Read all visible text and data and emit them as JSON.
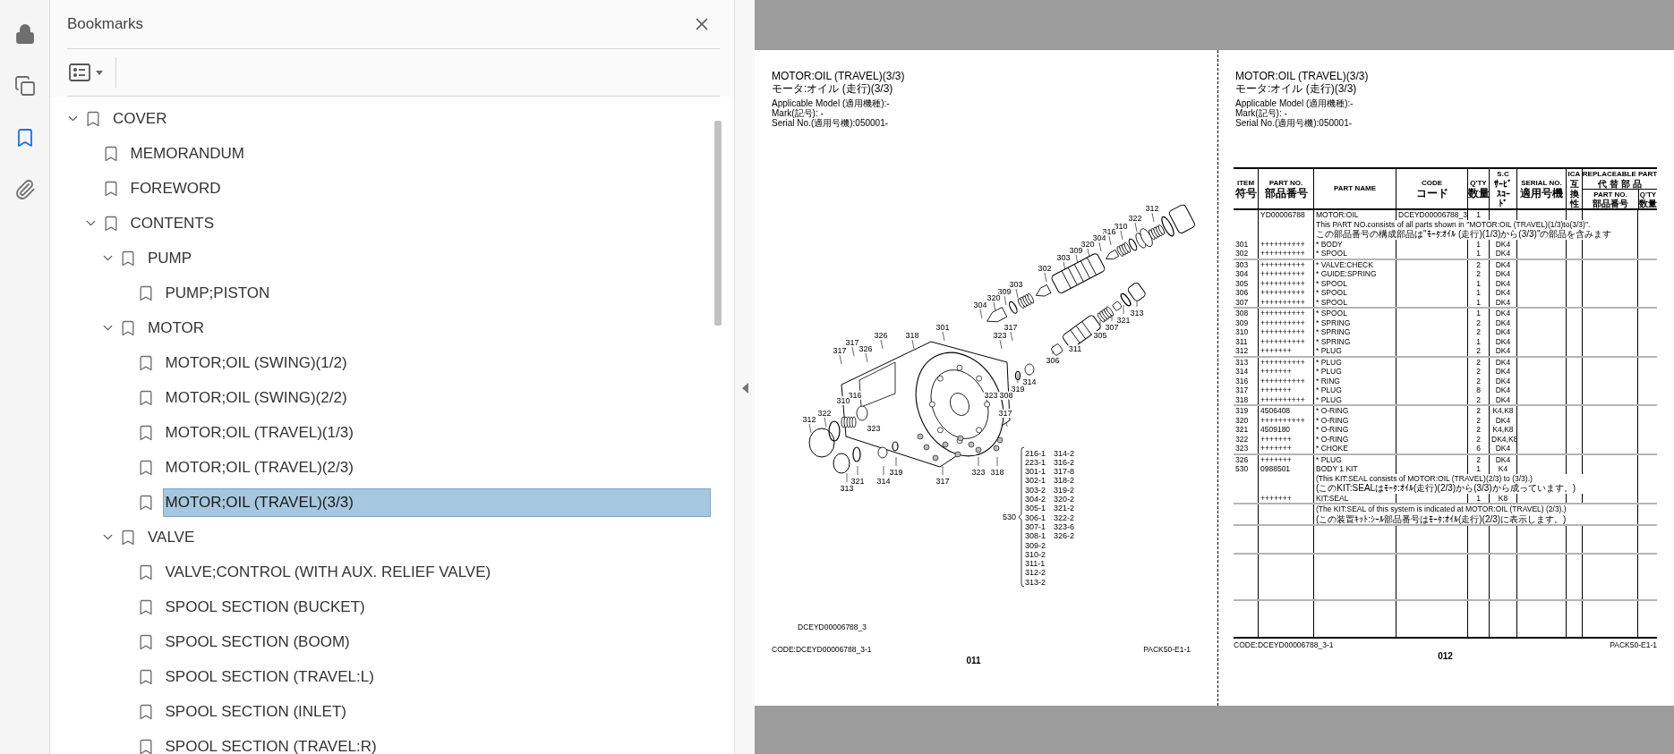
{
  "rail_tools": [
    {
      "selected": false
    },
    {
      "selected": false
    },
    {
      "selected": true
    },
    {
      "selected": false
    }
  ],
  "bookmarks_panel": {
    "title": "Bookmarks",
    "items": [
      {
        "label": "COVER",
        "selected": false,
        "expanded": true,
        "children": [
          {
            "label": "MEMORANDUM",
            "selected": false
          },
          {
            "label": "FOREWORD",
            "selected": false
          },
          {
            "label": "CONTENTS",
            "selected": false,
            "expanded": true,
            "children": [
              {
                "label": "PUMP",
                "selected": false,
                "expanded": true,
                "children": [
                  {
                    "label": "PUMP;PISTON",
                    "selected": false
                  }
                ]
              },
              {
                "label": "MOTOR",
                "selected": false,
                "expanded": true,
                "children": [
                  {
                    "label": "MOTOR;OIL (SWING)(1/2)",
                    "selected": false
                  },
                  {
                    "label": "MOTOR;OIL (SWING)(2/2)",
                    "selected": false
                  },
                  {
                    "label": "MOTOR;OIL (TRAVEL)(1/3)",
                    "selected": false
                  },
                  {
                    "label": "MOTOR;OIL (TRAVEL)(2/3)",
                    "selected": false
                  },
                  {
                    "label": "MOTOR;OIL (TRAVEL)(3/3)",
                    "selected": true
                  }
                ]
              },
              {
                "label": "VALVE",
                "selected": false,
                "expanded": true,
                "children": [
                  {
                    "label": "VALVE;CONTROL (WITH AUX. RELIEF VALVE)",
                    "selected": false
                  },
                  {
                    "label": "SPOOL SECTION (BUCKET)",
                    "selected": false
                  },
                  {
                    "label": "SPOOL SECTION (BOOM)",
                    "selected": false
                  },
                  {
                    "label": "SPOOL SECTION (TRAVEL:L)",
                    "selected": false
                  },
                  {
                    "label": "SPOOL SECTION (INLET)",
                    "selected": false
                  },
                  {
                    "label": "SPOOL SECTION (TRAVEL:R)",
                    "selected": false
                  }
                ]
              }
            ]
          }
        ]
      }
    ]
  },
  "left_page": {
    "title": "MOTOR:OIL (TRAVEL)(3/3)",
    "title_ja": "モータ:オイル (走行)(3/3)",
    "info": [
      "Applicable Model (適用機種):-",
      "Mark(記号): -",
      "Serial No.(適用号機):050001-"
    ],
    "callouts": [
      "312",
      "322",
      "310",
      "316",
      "304",
      "320",
      "309",
      "303",
      "302",
      "303",
      "309",
      "320",
      "304",
      "313",
      "321",
      "301",
      "317",
      "307",
      "326",
      "318",
      "323",
      "305",
      "317",
      "317",
      "326",
      "311",
      "306",
      "314",
      "319",
      "316",
      "323",
      "308",
      "310",
      "322",
      "317",
      "312",
      "323",
      "319",
      "323",
      "318",
      "321",
      "314",
      "317",
      "313"
    ],
    "kit": {
      "number": "530",
      "items": [
        "216-1",
        "223-1",
        "301-1",
        "302-1",
        "303-2",
        "304-2",
        "305-1",
        "306-1",
        "307-1",
        "308-1",
        "309-2",
        "310-2",
        "311-1",
        "312-2",
        "313-2",
        "314-2",
        "316-2",
        "317-8",
        "318-2",
        "319-2",
        "320-2",
        "321-2",
        "322-2",
        "323-6",
        "326-2"
      ]
    },
    "drawing_code": "DCEYD00006788_3",
    "footer_code": "CODE:DCEYD00006788_3-1",
    "footer_pack": "PACK50-E1-1",
    "page_number": "011"
  },
  "right_page": {
    "title": "MOTOR:OIL (TRAVEL)(3/3)",
    "title_ja": "モータ:オイル (走行)(3/3)",
    "info": [
      "Applicable Model (適用機種):-",
      "Mark(記号): -",
      "Serial No.(適用号機):050001-"
    ],
    "table": {
      "columns": [
        {
          "en": "ITEM",
          "ja": "符号"
        },
        {
          "en": "PART NO.",
          "ja": "部品番号"
        },
        {
          "en": "PART NAME"
        },
        {
          "en": "CODE",
          "ja": "コード"
        },
        {
          "en": "Q'TY",
          "ja": "数量"
        },
        {
          "en": "S.C",
          "ja": "ｻｰﾋﾞｽｺｰﾄﾞ"
        },
        {
          "en": "SERIAL NO.",
          "ja": "適用号機"
        },
        {
          "en": "ICA",
          "ja": "互換性"
        }
      ],
      "replaceable": {
        "en": "REPLACEABLE PART",
        "ja": "代 替 部 品",
        "columns": [
          {
            "en": "PART NO.",
            "ja": "部品番号"
          },
          {
            "en": "Q'TY",
            "ja": "数量"
          }
        ]
      },
      "groups": [
        {
          "rows": [
            {
              "kind": "item",
              "part_no": "YD00006788",
              "name": "MOTOR:OIL",
              "code": "DCEYD00006788_3",
              "qty": "1"
            },
            {
              "kind": "note",
              "text": "This PART NO.consists of all parts shown in \"MOTOR:OIL (TRAVEL)(1/3)to(3/3)\"."
            },
            {
              "kind": "note_ja",
              "text": "この部品番号の構成部品は\"ﾓｰﾀ:ｵｲﾙ (走行)(1/3)から(3/3)\"の部品を含みます"
            },
            {
              "kind": "item",
              "item": "301",
              "part_no": "++++++++++",
              "name": "* BODY",
              "qty": "1",
              "sc": "DK4"
            },
            {
              "kind": "item",
              "item": "302",
              "part_no": "++++++++++",
              "name": "* SPOOL",
              "qty": "1",
              "sc": "DK4"
            }
          ]
        },
        {
          "rows": [
            {
              "kind": "item",
              "item": "303",
              "part_no": "++++++++++",
              "name": "* VALVE:CHECK",
              "qty": "2",
              "sc": "DK4"
            },
            {
              "kind": "item",
              "item": "304",
              "part_no": "++++++++++",
              "name": "* GUIDE:SPRING",
              "qty": "2",
              "sc": "DK4"
            },
            {
              "kind": "item",
              "item": "305",
              "part_no": "++++++++++",
              "name": "* SPOOL",
              "qty": "1",
              "sc": "DK4"
            },
            {
              "kind": "item",
              "item": "306",
              "part_no": "++++++++++",
              "name": "* SPOOL",
              "qty": "1",
              "sc": "DK4"
            },
            {
              "kind": "item",
              "item": "307",
              "part_no": "++++++++++",
              "name": "* SPOOL",
              "qty": "1",
              "sc": "DK4"
            }
          ]
        },
        {
          "rows": [
            {
              "kind": "item",
              "item": "308",
              "part_no": "++++++++++",
              "name": "* SPOOL",
              "qty": "1",
              "sc": "DK4"
            },
            {
              "kind": "item",
              "item": "309",
              "part_no": "++++++++++",
              "name": "* SPRING",
              "qty": "2",
              "sc": "DK4"
            },
            {
              "kind": "item",
              "item": "310",
              "part_no": "++++++++++",
              "name": "* SPRING",
              "qty": "2",
              "sc": "DK4"
            },
            {
              "kind": "item",
              "item": "311",
              "part_no": "++++++++++",
              "name": "* SPRING",
              "qty": "1",
              "sc": "DK4"
            },
            {
              "kind": "item",
              "item": "312",
              "part_no": "+++++++",
              "name": "* PLUG",
              "qty": "2",
              "sc": "DK4"
            }
          ]
        },
        {
          "rows": [
            {
              "kind": "item",
              "item": "313",
              "part_no": "++++++++++",
              "name": "* PLUG",
              "qty": "2",
              "sc": "DK4"
            },
            {
              "kind": "item",
              "item": "314",
              "part_no": "+++++++",
              "name": "* PLUG",
              "qty": "2",
              "sc": "DK4"
            },
            {
              "kind": "item",
              "item": "316",
              "part_no": "++++++++++",
              "name": "* RING",
              "qty": "2",
              "sc": "DK4"
            },
            {
              "kind": "item",
              "item": "317",
              "part_no": "+++++++",
              "name": "* PLUG",
              "qty": "8",
              "sc": "DK4"
            },
            {
              "kind": "item",
              "item": "318",
              "part_no": "++++++++++",
              "name": "* PLUG",
              "qty": "2",
              "sc": "DK4"
            }
          ]
        },
        {
          "rows": [
            {
              "kind": "item",
              "item": "319",
              "part_no": "4506408",
              "name": "* O-RING",
              "qty": "2",
              "sc": "K4,K8"
            },
            {
              "kind": "item",
              "item": "320",
              "part_no": "++++++++++",
              "name": "* O-RING",
              "qty": "2",
              "sc": "DK4"
            },
            {
              "kind": "item",
              "item": "321",
              "part_no": "4509180",
              "name": "* O-RING",
              "qty": "2",
              "sc": "K4,K8"
            },
            {
              "kind": "item",
              "item": "322",
              "part_no": "+++++++",
              "name": "* O-RING",
              "qty": "2",
              "sc": "DK4,K8"
            },
            {
              "kind": "item",
              "item": "323",
              "part_no": "+++++++",
              "name": "* CHOKE",
              "qty": "6",
              "sc": "DK4"
            }
          ]
        },
        {
          "rows": [
            {
              "kind": "item",
              "item": "326",
              "part_no": "+++++++",
              "name": "* PLUG",
              "qty": "2",
              "sc": "DK4"
            },
            {
              "kind": "item",
              "item": "530",
              "part_no": "0988501",
              "name": "BODY 1 KIT",
              "qty": "1",
              "sc": "K4"
            },
            {
              "kind": "note",
              "text": "(This KIT:SEAL consists of MOTOR:OIL (TRAVEL)(2/3) to (3/3).)"
            },
            {
              "kind": "note_ja",
              "text": "(このKIT:SEALはﾓｰﾀ:ｵｲﾙ(走行)(2/3)から(3/3)から成っています。)"
            },
            {
              "kind": "item",
              "part_no": "+++++++",
              "name": "KIT:SEAL",
              "qty": "1",
              "sc": "K8"
            }
          ]
        },
        {
          "rows": [
            {
              "kind": "note",
              "text": "(The KIT:SEAL of this system is indicated at MOTOR:OIL (TRAVEL) (2/3).)"
            },
            {
              "kind": "note_ja",
              "text": "(この装置ｷｯﾄ:ｼｰﾙ部品番号はﾓｰﾀ:ｵｲﾙ(走行)(2/3)に表示します。)"
            }
          ]
        }
      ]
    },
    "footer_code": "CODE:DCEYD00006788_3-1",
    "footer_pack": "PACK50-E1-1",
    "page_number": "012"
  }
}
